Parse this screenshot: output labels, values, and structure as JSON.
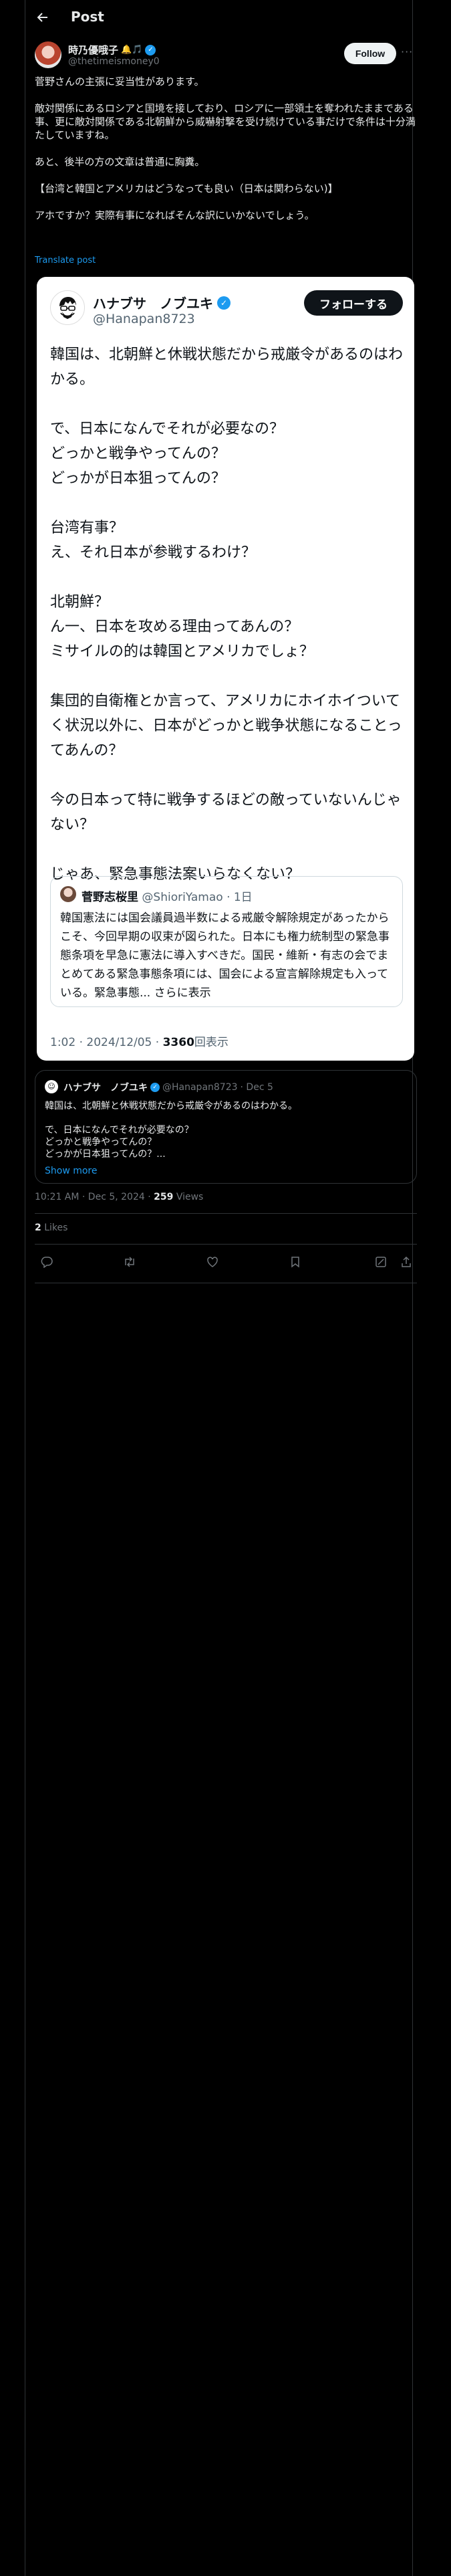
{
  "header": {
    "title": "Post"
  },
  "author": {
    "name": "時乃優哦子",
    "emoji": "🔔🎵",
    "handle": "@thetimeismoney0",
    "follow_label": "Follow"
  },
  "post": {
    "paragraphs": [
      "菅野さんの主張に妥当性があります。",
      "敵対関係にあるロシアと国境を接しており、ロシアに一部領土を奪われたままである事、更に敵対関係である北朝鮮から威嚇射撃を受け続けている事だけで条件は十分満たしていますね。",
      "あと、後半の方の文章は普通に胸糞。",
      "【台湾と韓国とアメリカはどうなっても良い（日本は関わらない)】",
      "アホですか？実際有事になればそんな訳にいかないでしょう。"
    ],
    "translate_label": "Translate post"
  },
  "screenshot_card": {
    "name": "ハナブサ　ノブユキ",
    "handle": "@Hanapan8723",
    "follow_label": "フォローする",
    "paragraphs": [
      "韓国は、北朝鮮と休戦状態だから戒厳令があるのはわかる。",
      "で、日本になんでそれが必要なの？\nどっかと戦争やってんの？\nどっかが日本狙ってんの？",
      "台湾有事？\nえ、それ日本が参戦するわけ？",
      "北朝鮮？\nん一、日本を攻める理由ってあんの？\nミサイルの的は韓国とアメリカでしょ？",
      "集団的自衛権とか言って、アメリカにホイホイついてく状況以外に、日本がどっかと戦争状態になることってあんの？",
      "今の日本って特に戦争するほどの敵っていないんじゃない？",
      "じゃあ、緊急事態法案いらなくない？"
    ],
    "quote": {
      "name": "菅野志桜里",
      "handle": "@ShioriYamao",
      "time": "· 1日",
      "text": "韓国憲法には国会議員過半数による戒厳令解除規定があったからこそ、今回早期の収束が図られた。日本にも権力統制型の緊急事態条項を早急に憲法に導入すべきだ。国民・維新・有志の会でまとめてある緊急事態条項には、国会による宣言解除規定も入っている。緊急事態...",
      "more": "さらに表示"
    },
    "meta_time": "1:02 · 2024/12/05 · ",
    "meta_views": "3360",
    "meta_views_label": "回表示"
  },
  "quoted_tweet": {
    "name": "ハナブサ　ノブユキ",
    "handle": "@Hanapan8723",
    "date": "· Dec 5",
    "lines": [
      "韓国は、北朝鮮と休戦状態だから戒厳令があるのはわかる。",
      "",
      "で、日本になんでそれが必要なの？",
      "どっかと戦争やってんの？",
      "どっかが日本狙ってんの？..."
    ],
    "show_more": "Show more"
  },
  "meta": {
    "time": "10:21 AM · Dec 5, 2024 · ",
    "views": "259",
    "views_label": " Views"
  },
  "likes": {
    "count": "2",
    "label": " Likes"
  },
  "actions": {
    "reply_icon": "reply-icon",
    "repost_icon": "repost-icon",
    "like_icon": "like-icon",
    "bookmark_icon": "bookmark-icon",
    "grok_icon": "grok-icon",
    "share_icon": "share-icon"
  }
}
